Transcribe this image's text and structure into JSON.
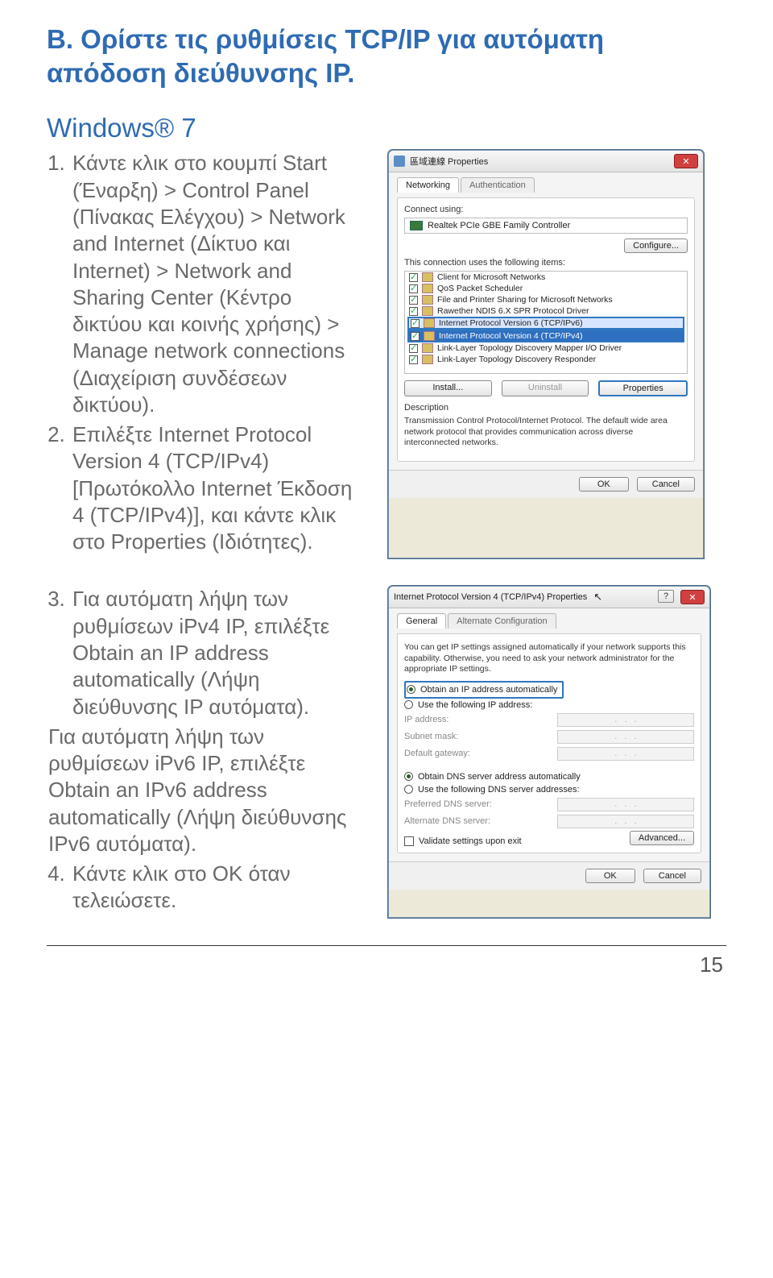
{
  "section": {
    "head_prefix": "B.",
    "head_text": "Ορίστε τις ρυθμίσεις TCP/IP για αυτόματη απόδοση διεύθυνσης IP.",
    "subhead": "Windows® 7"
  },
  "steps_a": {
    "s1": "Κάντε κλικ στο κουμπί Start (Έναρξη) > Control Panel (Πίνακας Ελέγχου) > Network and Internet (Δίκτυο και Internet) > Network and Sharing Center (Κέντρο δικτύου και κοινής χρήσης) > Manage network connections (Διαχείριση συνδέσεων δικτύου).",
    "s2": "Επιλέξτε Internet Protocol Version 4 (TCP/IPv4) [Πρωτόκολλο Internet Έκδοση 4 (TCP/IPv4)], και κάντε κλικ στο Properties (Ιδιότητες)."
  },
  "steps_b": {
    "s3": "Για αυτόματη λήψη των ρυθμίσεων iPv4 IP, επιλέξτε Obtain an IP address automatically (Λήψη διεύθυνσης IP αυτόματα).",
    "s3b": "Για αυτόματη λήψη των ρυθμίσεων iPv6 IP, επιλέξτε Obtain an IPv6 address automatically (Λήψη διεύθυνσης IPv6 αυτόματα).",
    "s4": "Κάντε κλικ στο OK όταν τελειώσετε."
  },
  "win1": {
    "title": "區域連線 Properties",
    "tab1": "Networking",
    "tab2": "Authentication",
    "connect_using": "Connect using:",
    "adapter": "Realtek PCIe GBE Family Controller",
    "configure": "Configure...",
    "uses_items": "This connection uses the following items:",
    "items": [
      "Client for Microsoft Networks",
      "QoS Packet Scheduler",
      "File and Printer Sharing for Microsoft Networks",
      "Rawether NDIS 6.X SPR Protocol Driver",
      "Internet Protocol Version 6 (TCP/IPv6)",
      "Internet Protocol Version 4 (TCP/IPv4)",
      "Link-Layer Topology Discovery Mapper I/O Driver",
      "Link-Layer Topology Discovery Responder"
    ],
    "install": "Install...",
    "uninstall": "Uninstall",
    "properties": "Properties",
    "desc_label": "Description",
    "desc_text": "Transmission Control Protocol/Internet Protocol. The default wide area network protocol that provides communication across diverse interconnected networks.",
    "ok": "OK",
    "cancel": "Cancel"
  },
  "win2": {
    "title": "Internet Protocol Version 4 (TCP/IPv4) Properties",
    "tab1": "General",
    "tab2": "Alternate Configuration",
    "intro": "You can get IP settings assigned automatically if your network supports this capability. Otherwise, you need to ask your network administrator for the appropriate IP settings.",
    "r1": "Obtain an IP address automatically",
    "r2": "Use the following IP address:",
    "f_ip": "IP address:",
    "f_mask": "Subnet mask:",
    "f_gw": "Default gateway:",
    "r3": "Obtain DNS server address automatically",
    "r4": "Use the following DNS server addresses:",
    "f_pdns": "Preferred DNS server:",
    "f_adns": "Alternate DNS server:",
    "validate": "Validate settings upon exit",
    "advanced": "Advanced...",
    "ok": "OK",
    "cancel": "Cancel"
  },
  "page_number": "15"
}
